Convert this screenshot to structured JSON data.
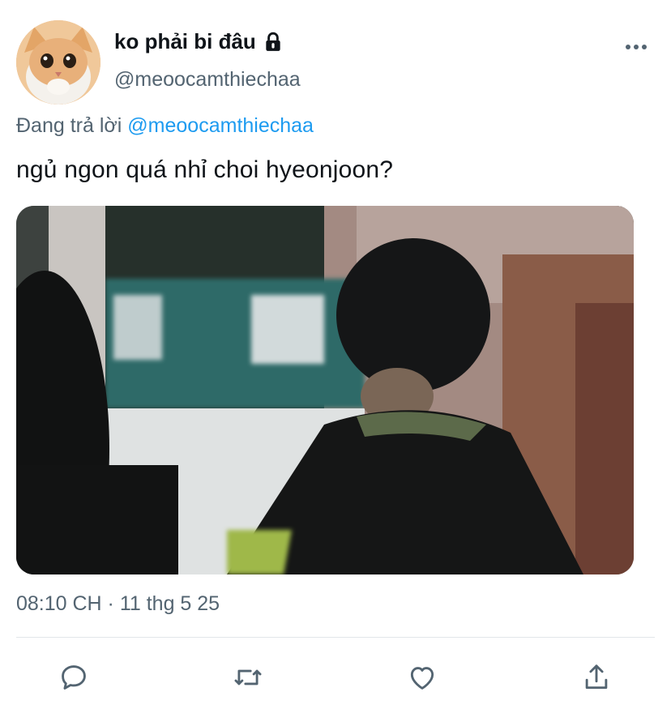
{
  "user": {
    "display_name": "ko phải bi đâu",
    "handle": "@meoocamthiechaa",
    "avatar_icon": "cat-avatar",
    "protected_icon": "lock-icon"
  },
  "replying_to": {
    "prefix": "Đang trả lời",
    "mention": "@meoocamthiechaa"
  },
  "tweet": {
    "text": "ngủ ngon quá nhỉ choi hyeonjoon?",
    "timestamp": "08:10 CH · 11 thg 5 25"
  },
  "actions": {
    "reply": "reply-icon",
    "retweet": "retweet-icon",
    "like": "heart-icon",
    "share": "share-icon"
  },
  "colors": {
    "text_primary": "#0f1419",
    "text_secondary": "#536471",
    "link": "#1d9bf0",
    "divider": "#e1e6ea"
  }
}
